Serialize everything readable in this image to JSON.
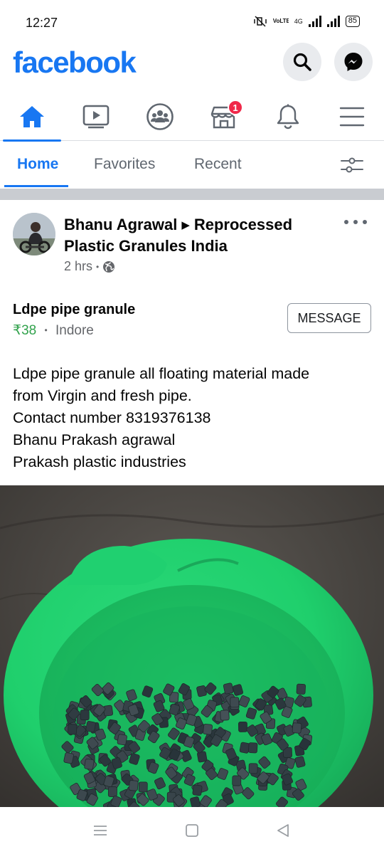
{
  "status_bar": {
    "time": "12:27",
    "network_label": "VoLTE",
    "network_type": "4G",
    "battery": "85"
  },
  "header": {
    "logo": "facebook",
    "brand_color": "#1877f2",
    "search_icon": "search-icon",
    "messenger_icon": "messenger-icon"
  },
  "nav": {
    "items": [
      {
        "name": "home-icon",
        "active": true
      },
      {
        "name": "watch-icon",
        "active": false
      },
      {
        "name": "groups-icon",
        "active": false
      },
      {
        "name": "marketplace-icon",
        "active": false,
        "badge": "1"
      },
      {
        "name": "notifications-icon",
        "active": false
      },
      {
        "name": "menu-icon",
        "active": false
      }
    ],
    "marketplace_badge": "1"
  },
  "feed_tabs": {
    "home": "Home",
    "favorites": "Favorites",
    "recent": "Recent"
  },
  "post": {
    "author": "Bhanu Agrawal",
    "group": "Reprocessed Plastic Granules India",
    "time": "2 hrs",
    "separator": "•",
    "privacy_icon": "globe-icon",
    "listing": {
      "title": "Ldpe pipe granule",
      "price": "₹38",
      "location": "Indore",
      "message_label": "MESSAGE"
    },
    "body_lines": [
      "Ldpe pipe granule all floating material made",
      "from Virgin and fresh pipe.",
      "Contact number 8319376138",
      "Bhanu Prakash agrawal",
      "Prakash plastic industries"
    ]
  },
  "system_nav": {
    "items": [
      "recent-apps-icon",
      "home-circle-icon",
      "back-icon"
    ]
  }
}
